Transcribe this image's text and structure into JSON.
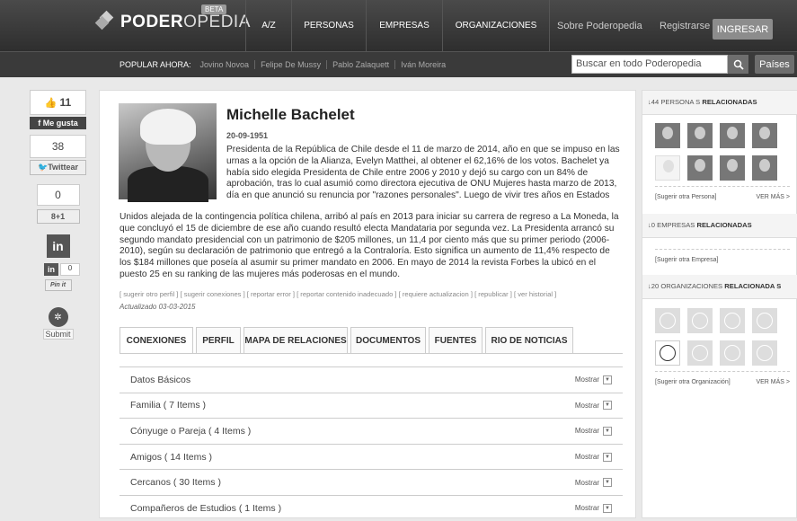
{
  "header": {
    "logo_bold": "PODER",
    "logo_light": "OPEDIA",
    "beta": "BETA",
    "nav": [
      "A/Z",
      "PERSONAS",
      "EMPRESAS",
      "ORGANIZACIONES"
    ],
    "about": "Sobre Poderopedia",
    "register": "Registrarse",
    "login": "INGRESAR"
  },
  "subbar": {
    "popular_label": "POPULAR AHORA:",
    "popular": [
      "Jovino Novoa",
      "Felipe De Mussy",
      "Pablo Zalaquett",
      "Iván Moreira"
    ],
    "search_placeholder": "Buscar en todo Poderopedia",
    "countries": "Países"
  },
  "social": {
    "likes": "11",
    "fb_label": "Me gusta",
    "tweets": "38",
    "twitter_label": "Twittear",
    "gplus": "0",
    "gplus_label": "8+1",
    "linkedin_count": "0",
    "pinit": "Pin it",
    "submit": "Submit"
  },
  "profile": {
    "name": "Michelle Bachelet",
    "date": "20-09-1951",
    "bio_top": "Presidenta de la República de Chile desde el 11 de marzo de 2014, año en que se impuso en las urnas a la opción de la Alianza, Evelyn Matthei, al obtener el 62,16% de los votos. Bachelet ya había sido elegida Presidenta de Chile entre 2006 y 2010 y dejó su cargo con un 84% de aprobación, tras lo cual asumió como directora ejecutiva de ONU Mujeres hasta marzo de 2013, día en que anunció su renuncia por \"razones personales\". Luego de vivir tres años en Estados",
    "bio_bottom": "Unidos alejada de la contingencia política chilena, arribó al país en 2013 para iniciar su carrera de regreso a La Moneda, la que concluyó el 15 de diciembre de ese año cuando resultó electa Mandataria por segunda vez. La Presidenta arrancó su segundo mandato presidencial con un patrimonio de $205 millones, un 11,4 por ciento más que su primer periodo (2006-2010), según su declaración de patrimonio que entregó a la Contraloría. Esto significa un aumento de 11,4% respecto de los $184 millones que poseía al asumir su primer mandato en 2006. En mayo de 2014 la revista Forbes la ubicó en el puesto 25 en su ranking de las mujeres más poderosas en el mundo.",
    "actions": "[ sugerir otro perfil ]  [ sugerir conexiones ]  [ reportar error ]  [ reportar contenido inadecuado ]  [ requiere actualizacion ]  [ republicar ]  [ ver historial ]",
    "updated": "Actualizado 03-03-2015"
  },
  "tabs": [
    "CONEXIONES",
    "PERFIL",
    "MAPA DE RELACIONES",
    "DOCUMENTOS",
    "FUENTES",
    "RIO DE NOTICIAS"
  ],
  "sections": [
    {
      "label": "Datos Básicos",
      "action": "Mostrar"
    },
    {
      "label": "Familia ( 7 Items )",
      "action": "Mostrar"
    },
    {
      "label": "Cónyuge o Pareja ( 4 Items )",
      "action": "Mostrar"
    },
    {
      "label": "Amigos ( 14 Items )",
      "action": "Mostrar"
    },
    {
      "label": "Cercanos ( 30 Items )",
      "action": "Mostrar"
    },
    {
      "label": "Compañeros de Estudios ( 1 Items )",
      "action": "Mostrar"
    }
  ],
  "right": {
    "personas_count": "↓44 PERSONA S",
    "personas_label": "RELACIONADAS",
    "sugerir_persona": "[Sugerir otra Persona]",
    "ver_mas_1": "VER MÁS >",
    "empresas_count": "↓0 EMPRESAS",
    "empresas_label": "RELACIONADAS",
    "sugerir_empresa": "[Sugerir otra Empresa]",
    "org_count": "↓20 ORGANIZACIONES",
    "org_label": "RELACIONADA S",
    "sugerir_org": "[Sugerir otra Organización]",
    "ver_mas_2": "VER MÁS >"
  }
}
